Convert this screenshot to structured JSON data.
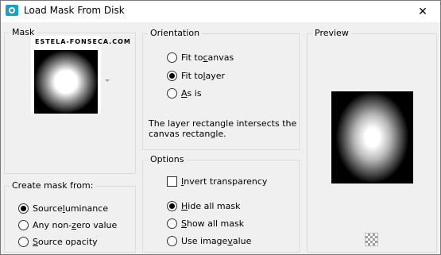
{
  "window": {
    "title": "Load Mask From Disk",
    "close_glyph": "✕",
    "icon": "app-logo-icon"
  },
  "mask": {
    "legend": "Mask",
    "caption": "ESTELA-FONSECA.COM"
  },
  "create_mask_from": {
    "legend": "Create mask from:",
    "options": [
      {
        "pre": "Source ",
        "key": "l",
        "post": "uminance",
        "checked": true
      },
      {
        "pre": "Any non-",
        "key": "z",
        "post": "ero value",
        "checked": false
      },
      {
        "pre": "",
        "key": "S",
        "post": "ource opacity",
        "checked": false
      }
    ]
  },
  "orientation": {
    "legend": "Orientation",
    "options": [
      {
        "pre": "Fit to ",
        "key": "c",
        "post": "anvas",
        "checked": false
      },
      {
        "pre": "Fit to ",
        "key": "l",
        "post": "ayer",
        "checked": true
      },
      {
        "pre": "",
        "key": "A",
        "post": "s is",
        "checked": false
      }
    ],
    "description": "The layer rectangle intersects the canvas rectangle."
  },
  "options": {
    "legend": "Options",
    "invert": {
      "pre": "",
      "key": "I",
      "post": "nvert transparency",
      "checked": false
    },
    "radios": [
      {
        "pre": "",
        "key": "H",
        "post": "ide all mask",
        "checked": true
      },
      {
        "pre": "",
        "key": "S",
        "post": "how all mask",
        "checked": false
      },
      {
        "pre": "Use image ",
        "key": "v",
        "post": "alue",
        "checked": false
      }
    ]
  },
  "preview": {
    "legend": "Preview"
  },
  "colors": {
    "accent": "#1aa0c8",
    "background": "#f0f0f0",
    "border": "#dcdcdc"
  }
}
